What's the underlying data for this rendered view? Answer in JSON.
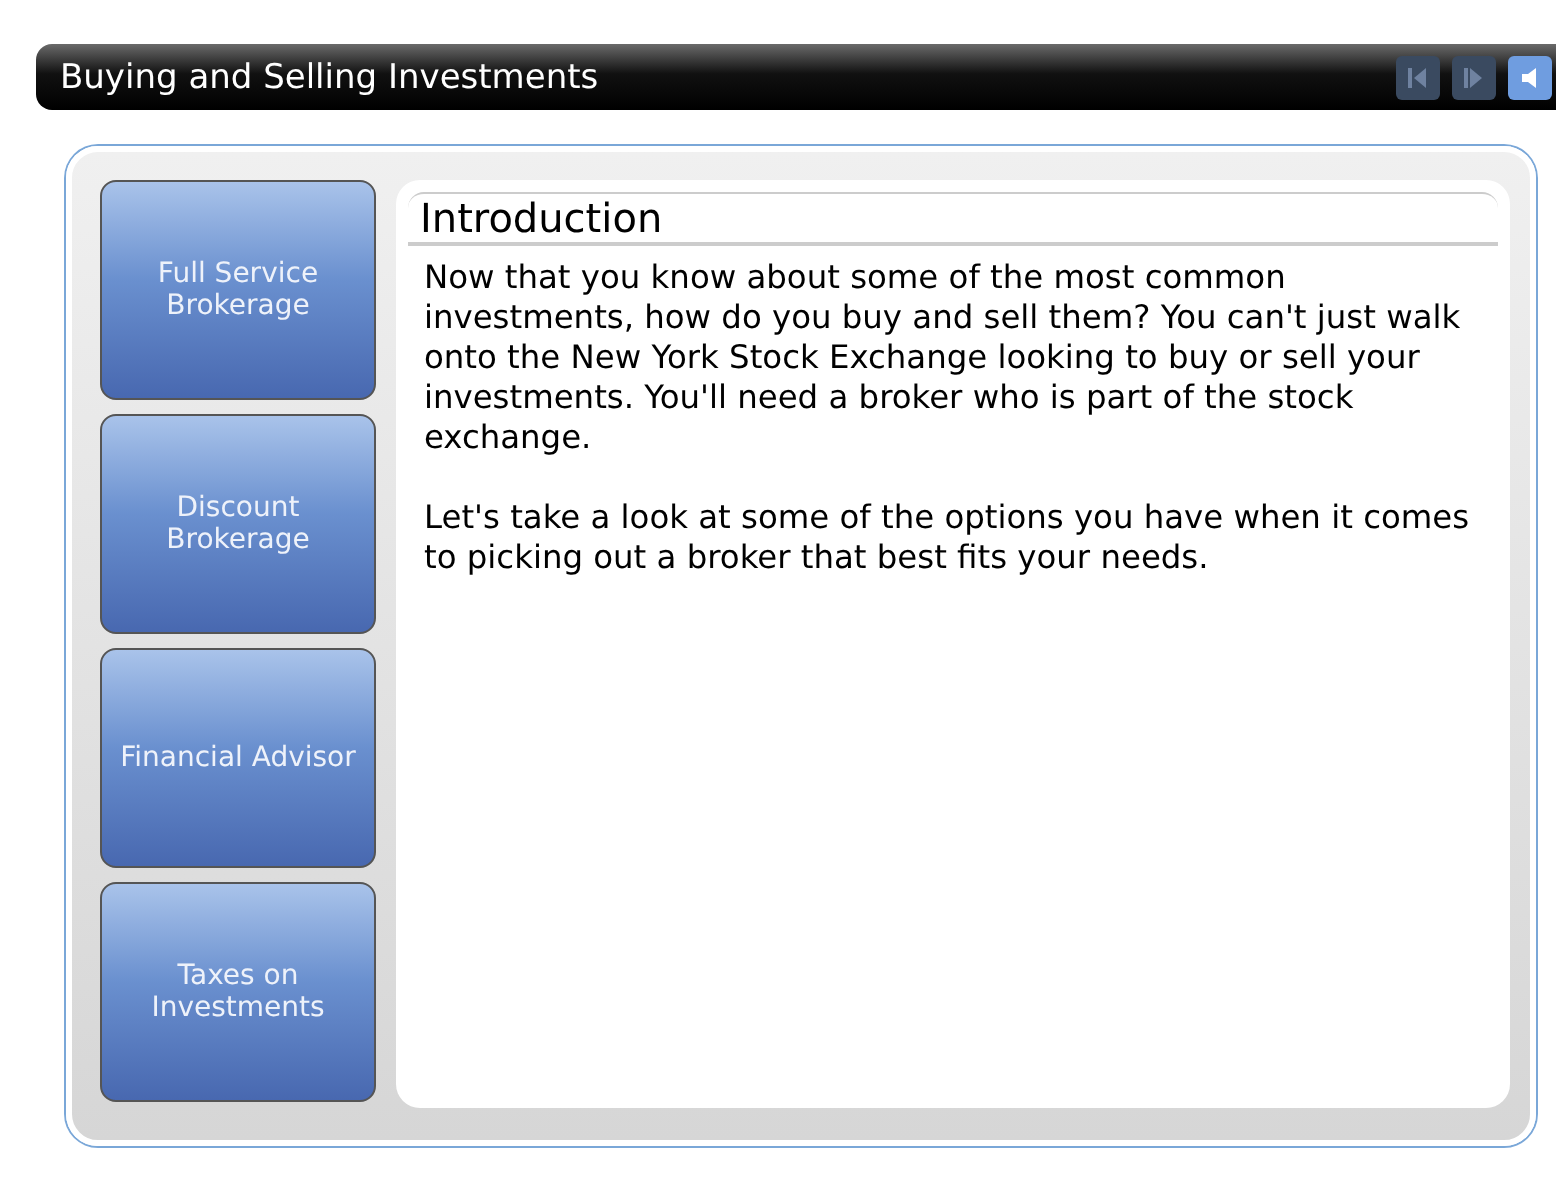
{
  "window": {
    "title": "Buying and Selling Investments"
  },
  "controls": [
    {
      "kind": "prev",
      "disabled": true
    },
    {
      "kind": "next",
      "disabled": true
    },
    {
      "kind": "sound",
      "disabled": false
    }
  ],
  "sidebar": {
    "items": [
      {
        "label": "Full Service Brokerage"
      },
      {
        "label": "Discount Brokerage"
      },
      {
        "label": "Financial Advisor"
      },
      {
        "label": "Taxes on Investments"
      }
    ]
  },
  "content": {
    "heading": "Introduction",
    "paragraphs": [
      "Now that you know about some of the most common investments, how do you buy and sell them? You can't just walk onto the New York Stock Exchange looking to buy or sell your investments. You'll need a broker who is part of the stock exchange.",
      "Let's take a look at some of the options you have when it comes to picking out a broker that best fits your needs."
    ]
  }
}
